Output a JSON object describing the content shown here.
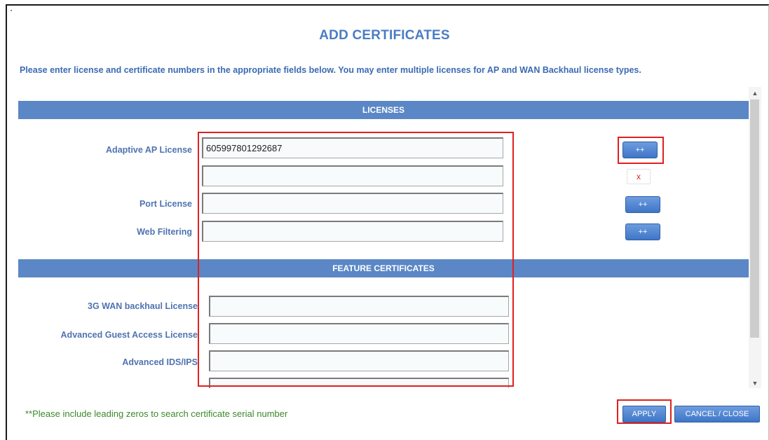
{
  "dialog": {
    "title": "ADD CERTIFICATES",
    "instructions": "Please enter license and certificate numbers in the appropriate fields below. You may enter multiple licenses for AP and WAN Backhaul license types."
  },
  "licenses": {
    "section_title": "LICENSES",
    "adaptive_ap": {
      "label": "Adaptive AP License",
      "value": "605997801292687",
      "second_value": "",
      "add_label": "++",
      "remove_label": "x"
    },
    "port": {
      "label": "Port License",
      "value": "",
      "add_label": "++"
    },
    "web_filtering": {
      "label": "Web Filtering",
      "value": "",
      "add_label": "++"
    }
  },
  "feature_certificates": {
    "section_title": "FEATURE CERTIFICATES",
    "items": [
      {
        "label": "3G WAN backhaul License",
        "value": ""
      },
      {
        "label": "Advanced Guest Access License",
        "value": ""
      },
      {
        "label": "Advanced IDS/IPS",
        "value": ""
      },
      {
        "label": "",
        "value": ""
      }
    ]
  },
  "scrollbar": {
    "up_icon": "triangle-up",
    "down_icon": "triangle-down"
  },
  "footer": {
    "note": "**Please include leading zeros to search certificate serial number",
    "apply_label": "APPLY",
    "cancel_label": "CANCEL / CLOSE"
  },
  "colors": {
    "accent": "#5b87c6",
    "highlight": "#e02020",
    "note_green": "#3a8a2a"
  }
}
